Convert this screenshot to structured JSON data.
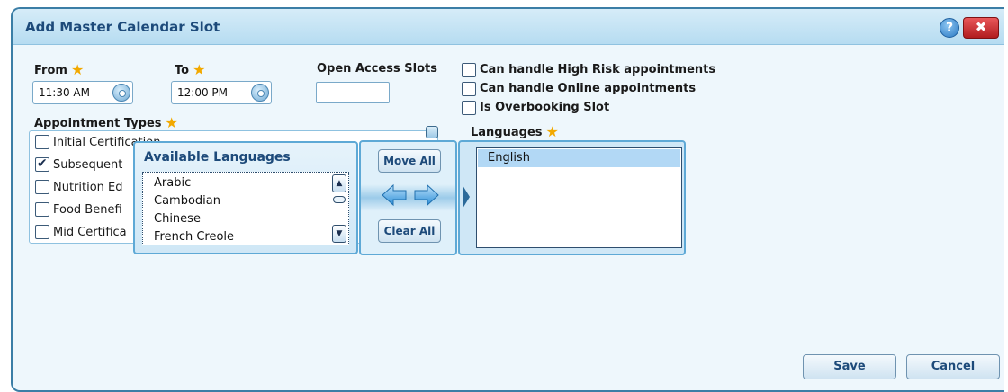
{
  "dialog": {
    "title": "Add Master Calendar Slot",
    "help_icon_glyph": "?",
    "close_icon_glyph": "✖"
  },
  "form": {
    "from": {
      "label": "From",
      "value": "11:30 AM"
    },
    "to": {
      "label": "To",
      "value": "12:00 PM"
    },
    "open_access": {
      "label": "Open Access Slots",
      "value": ""
    },
    "options": [
      {
        "label": "Can handle High Risk appointments",
        "checked": false
      },
      {
        "label": "Can handle Online appointments",
        "checked": false
      },
      {
        "label": "Is Overbooking Slot",
        "checked": false
      }
    ],
    "star_glyph": "★"
  },
  "appointment_types": {
    "label": "Appointment Types",
    "items": [
      {
        "label": "Initial Certification",
        "checked": false
      },
      {
        "label": "Subsequent",
        "checked": true
      },
      {
        "label": "Nutrition Ed",
        "checked": false
      },
      {
        "label": "Food Benefi",
        "checked": false
      },
      {
        "label": "Mid Certifica",
        "checked": false
      }
    ]
  },
  "available_languages": {
    "title": "Available Languages",
    "items": [
      "Arabic",
      "Cambodian",
      "Chinese",
      "French Creole"
    ]
  },
  "transfer": {
    "move_all": "Move All",
    "clear_all": "Clear All"
  },
  "languages": {
    "label": "Languages",
    "items": [
      "English"
    ],
    "selected": "English"
  },
  "footer": {
    "save": "Save",
    "cancel": "Cancel"
  },
  "colors": {
    "title_text": "#1d4a7a",
    "star": "#f2a900",
    "close_red": "#c62426",
    "selection": "#b2d8f5"
  },
  "icons": {
    "help": "help-icon",
    "close": "close-icon",
    "clock": "clock-icon",
    "star": "star-icon",
    "transfer": "left-right-arrows-icon"
  }
}
